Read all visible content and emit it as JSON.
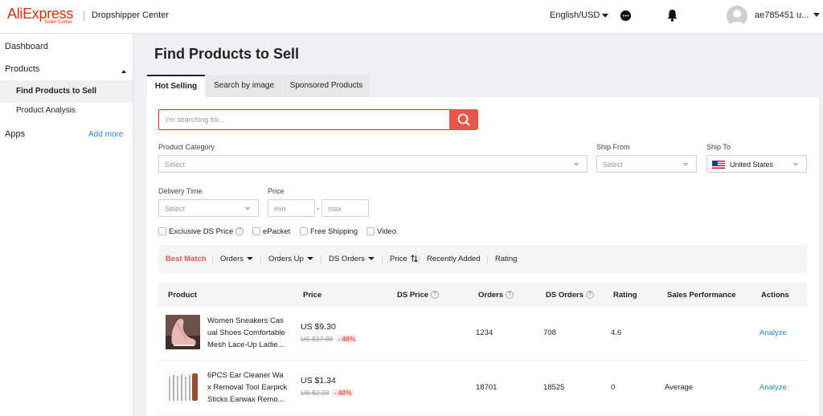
{
  "header": {
    "logo": "AliExpress",
    "logo_sub": "Seller Center",
    "app_title": "Dropshipper Center",
    "language": "English/USD",
    "username": "ae785451 u..."
  },
  "sidebar": {
    "dashboard": "Dashboard",
    "products": "Products",
    "find_products": "Find Products to Sell",
    "product_analysis": "Product Analysis",
    "apps": "Apps",
    "add_more": "Add more"
  },
  "page": {
    "title": "Find Products to Sell",
    "tabs": [
      "Hot Selling",
      "Search by image",
      "Sponsored Products"
    ]
  },
  "search": {
    "placeholder": "I'm searching for..."
  },
  "filters": {
    "product_category_label": "Product Category",
    "product_category_value": "Select",
    "ship_from_label": "Ship From",
    "ship_from_value": "Select",
    "ship_to_label": "Ship To",
    "ship_to_value": "United States",
    "delivery_time_label": "Delivery Time",
    "delivery_time_value": "Select",
    "price_label": "Price",
    "price_min": "min",
    "price_max": "max",
    "price_sep": "-"
  },
  "checkboxes": {
    "exclusive_ds_price": "Exclusive DS Price",
    "epacket": "ePacket",
    "free_shipping": "Free Shipping",
    "video": "Video"
  },
  "sort": {
    "best_match": "Best Match",
    "orders": "Orders",
    "orders_up": "Orders Up",
    "ds_orders": "DS Orders",
    "price": "Price",
    "recently_added": "Recently Added",
    "rating": "Rating"
  },
  "table": {
    "headers": {
      "product": "Product",
      "price": "Price",
      "ds_price": "DS Price",
      "orders": "Orders",
      "ds_orders": "DS Orders",
      "rating": "Rating",
      "sales_performance": "Sales Performance",
      "actions": "Actions"
    },
    "rows": [
      {
        "name_lines": [
          "Women Sneakers Cas",
          "ual Shoes Comfortable",
          "Mesh Lace-Up Ladie..."
        ],
        "price": "US $9.30",
        "old_price": "US $17.88",
        "discount": "- 48%",
        "ds_price": "",
        "orders": "1234",
        "ds_orders": "708",
        "rating": "4.6",
        "sales_performance": "",
        "action": "Analyze"
      },
      {
        "name_lines": [
          "6PCS Ear Cleaner Wa",
          "x Removal Tool Earpick",
          "Sticks Earwax Remo..."
        ],
        "price": "US $1.34",
        "old_price": "US $2.23",
        "discount": "- 40%",
        "ds_price": "",
        "orders": "18701",
        "ds_orders": "18525",
        "rating": "0",
        "sales_performance": "Average",
        "action": "Analyze"
      }
    ]
  },
  "colors": {
    "brand": "#e62e04",
    "accent": "#e8554a",
    "link": "#2b83d6"
  },
  "icons": [
    "chat-icon",
    "bell-icon",
    "search-icon",
    "help-icon",
    "sort-icon",
    "us-flag-icon"
  ]
}
